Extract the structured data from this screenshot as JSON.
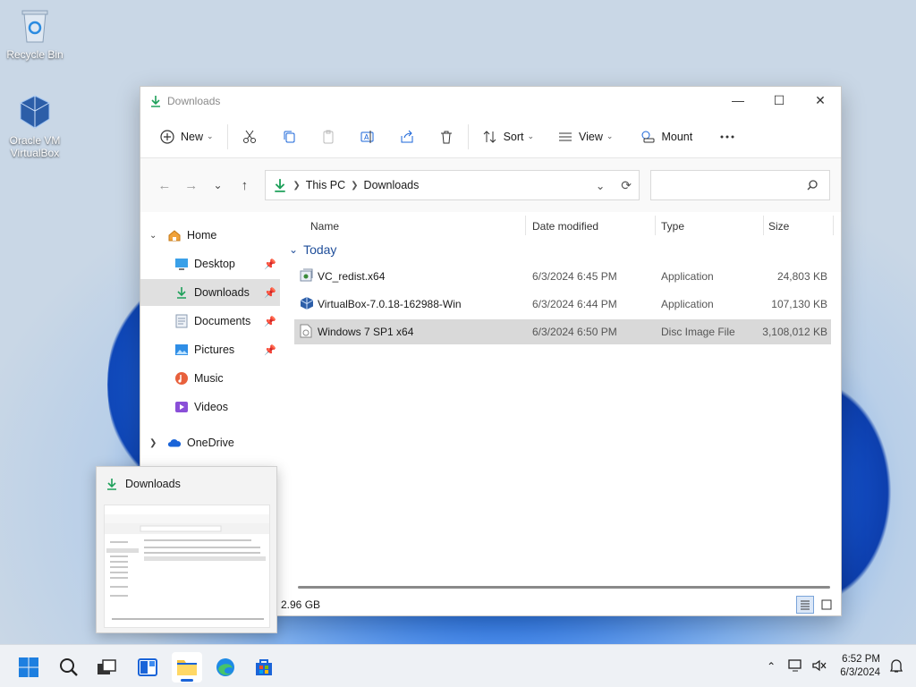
{
  "desktop": {
    "icons": [
      {
        "label": "Recycle Bin"
      },
      {
        "label": "Oracle VM VirtualBox"
      }
    ]
  },
  "window": {
    "title": "Downloads",
    "toolbar": {
      "new_label": "New",
      "sort_label": "Sort",
      "view_label": "View",
      "mount_label": "Mount"
    },
    "address": {
      "crumbs": [
        "This PC",
        "Downloads"
      ],
      "search_placeholder": ""
    },
    "nav": {
      "home": "Home",
      "items": [
        {
          "label": "Desktop",
          "pinned": true
        },
        {
          "label": "Downloads",
          "pinned": true,
          "selected": true
        },
        {
          "label": "Documents",
          "pinned": true
        },
        {
          "label": "Pictures",
          "pinned": true
        },
        {
          "label": "Music",
          "pinned": false
        },
        {
          "label": "Videos",
          "pinned": false
        }
      ],
      "onedrive": "OneDrive"
    },
    "columns": {
      "name": "Name",
      "date": "Date modified",
      "type": "Type",
      "size": "Size"
    },
    "group": "Today",
    "files": [
      {
        "name": "VC_redist.x64",
        "date": "6/3/2024 6:45 PM",
        "type": "Application",
        "size": "24,803 KB"
      },
      {
        "name": "VirtualBox-7.0.18-162988-Win",
        "date": "6/3/2024 6:44 PM",
        "type": "Application",
        "size": "107,130 KB"
      },
      {
        "name": "Windows 7 SP1 x64",
        "date": "6/3/2024 6:50 PM",
        "type": "Disc Image File",
        "size": "3,108,012 KB",
        "selected": true
      }
    ],
    "status": "2.96 GB"
  },
  "thumbnail": {
    "title": "Downloads"
  },
  "taskbar": {
    "time": "6:52 PM",
    "date": "6/3/2024"
  }
}
